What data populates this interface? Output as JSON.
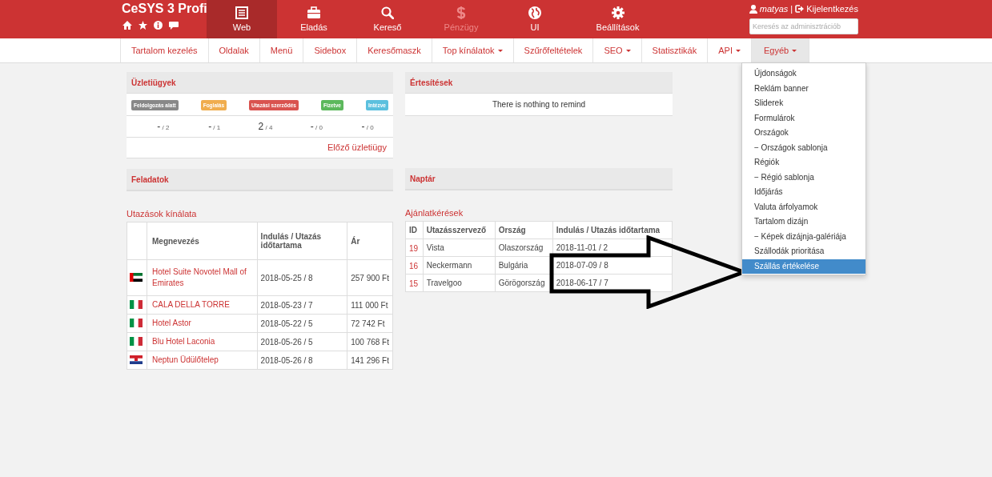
{
  "brand": {
    "title": "CeSYS 3 Profi",
    "icons": [
      {
        "kind": "home"
      },
      {
        "kind": "star"
      },
      {
        "kind": "info"
      },
      {
        "kind": "comment"
      }
    ]
  },
  "main_nav": [
    {
      "label": "Web",
      "kind": "list",
      "selected": true,
      "disabled": false
    },
    {
      "label": "Eladás",
      "kind": "briefcase",
      "selected": false,
      "disabled": false
    },
    {
      "label": "Kereső",
      "kind": "search",
      "selected": false,
      "disabled": false
    },
    {
      "label": "Pénzügy",
      "kind": "dollar",
      "selected": false,
      "disabled": true
    },
    {
      "label": "UI",
      "kind": "globe",
      "selected": false,
      "disabled": false
    },
    {
      "label": "Beállítások",
      "kind": "gear",
      "selected": false,
      "disabled": false
    }
  ],
  "user": {
    "name": "matyas",
    "separator": "|",
    "logout": "Kijelentkezés"
  },
  "admin_search": {
    "placeholder": "Keresés az adminisztrációb"
  },
  "sub_nav": [
    {
      "label": "Tartalom kezelés",
      "dropdown": false,
      "selected": false
    },
    {
      "label": "Oldalak",
      "dropdown": false,
      "selected": false
    },
    {
      "label": "Menü",
      "dropdown": false,
      "selected": false
    },
    {
      "label": "Sidebox",
      "dropdown": false,
      "selected": false
    },
    {
      "label": "Keresőmaszk",
      "dropdown": false,
      "selected": false
    },
    {
      "label": "Top kínálatok",
      "dropdown": true,
      "selected": false
    },
    {
      "label": "Szűrőfeltételek",
      "dropdown": false,
      "selected": false
    },
    {
      "label": "SEO",
      "dropdown": true,
      "selected": false
    },
    {
      "label": "Statisztikák",
      "dropdown": false,
      "selected": false
    },
    {
      "label": "API",
      "dropdown": true,
      "selected": false
    },
    {
      "label": "Egyéb",
      "dropdown": true,
      "selected": true
    }
  ],
  "dropdown_menu": [
    {
      "label": "Újdonságok",
      "selected": false
    },
    {
      "label": "Reklám banner",
      "selected": false
    },
    {
      "label": "Sliderek",
      "selected": false
    },
    {
      "label": "Formulárok",
      "selected": false
    },
    {
      "label": "Országok",
      "selected": false
    },
    {
      "label": "− Országok sablonja",
      "selected": false
    },
    {
      "label": "Régiók",
      "selected": false
    },
    {
      "label": "− Régió sablonja",
      "selected": false
    },
    {
      "label": "Időjárás",
      "selected": false
    },
    {
      "label": "Valuta árfolyamok",
      "selected": false
    },
    {
      "label": "Tartalom dizájn",
      "selected": false
    },
    {
      "label": "− Képek dizájnja-galériája",
      "selected": false
    },
    {
      "label": "Szállodák prioritása",
      "selected": false
    },
    {
      "label": "Szállás értékelése",
      "selected": true
    }
  ],
  "business_panel": {
    "title": "Üzletiügyek",
    "statuses": [
      {
        "label": "Feldolgozás alatt",
        "color": "#888888",
        "value": "-",
        "total": "/ 2"
      },
      {
        "label": "Foglalás",
        "color": "#f0ad4e",
        "value": "-",
        "total": "/ 1"
      },
      {
        "label": "Utazási szerződés",
        "color": "#d9534f",
        "value": "2",
        "total": "/ 4"
      },
      {
        "label": "Fizetve",
        "color": "#5cb85c",
        "value": "-",
        "total": "/ 0"
      },
      {
        "label": "Intézve",
        "color": "#5bc0de",
        "value": "-",
        "total": "/ 0"
      }
    ],
    "link": "Előző üzletiügy"
  },
  "notifications_panel": {
    "title": "Értesítések",
    "message": "There is nothing to remind"
  },
  "tasks_panel": {
    "title": "Feladatok"
  },
  "calendar_panel": {
    "title": "Naptár"
  },
  "offers_table": {
    "title": "Utazások kínálata",
    "columns": [
      "Megnevezés",
      "Indulás / Utazás időtartama",
      "Ár"
    ],
    "rows": [
      {
        "kind": "uae",
        "name": "Hotel Suite Novotel Mall of Emirates",
        "date": "2018-05-25 / 8",
        "price": "257 900 Ft"
      },
      {
        "kind": "italy",
        "name": "CALA DELLA TORRE",
        "date": "2018-05-23 / 7",
        "price": "111 000 Ft"
      },
      {
        "kind": "italy",
        "name": "Hotel Astor",
        "date": "2018-05-22 / 5",
        "price": "72 742 Ft"
      },
      {
        "kind": "italy",
        "name": "Blu Hotel Laconia",
        "date": "2018-05-26 / 5",
        "price": "100 768 Ft"
      },
      {
        "kind": "croatia",
        "name": "Neptun Üdülőtelep",
        "date": "2018-05-26 / 8",
        "price": "141 296 Ft"
      }
    ]
  },
  "requests_table": {
    "title": "Ajánlatkérések",
    "columns": [
      "ID",
      "Utazásszervező",
      "Ország",
      "Indulás / Utazás időtartama"
    ],
    "rows": [
      {
        "id": "19",
        "organizer": "Vista",
        "country": "Olaszország",
        "date": "2018-11-01 / 2"
      },
      {
        "id": "16",
        "organizer": "Neckermann",
        "country": "Bulgária",
        "date": "2018-07-09 / 8"
      },
      {
        "id": "15",
        "organizer": "Travelgoo",
        "country": "Görögország",
        "date": "2018-06-17 / 7"
      }
    ]
  }
}
